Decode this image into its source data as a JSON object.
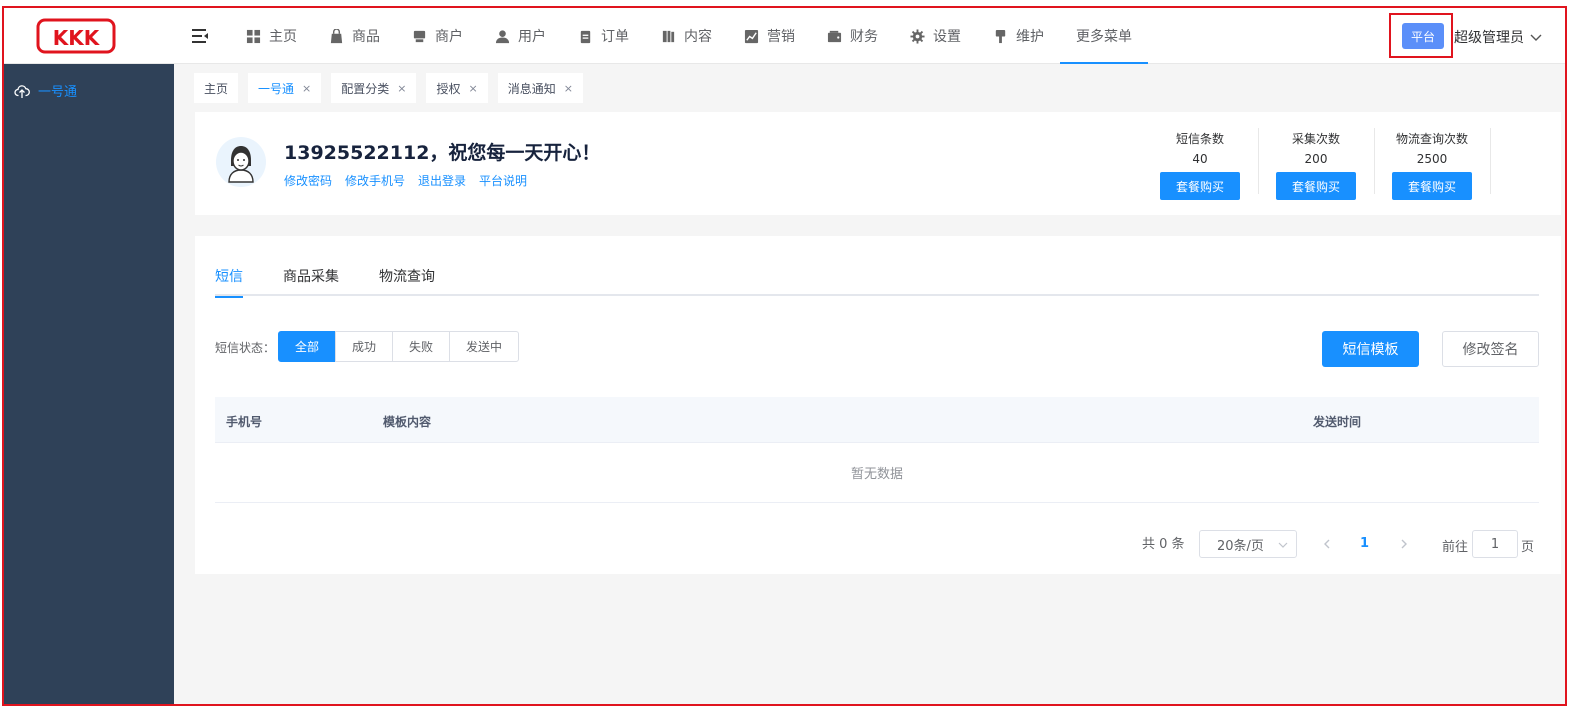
{
  "brand": {
    "logo_text": "KKK",
    "color": "#e0141e"
  },
  "nav": {
    "items": [
      {
        "label": "主页",
        "icon": "grid-icon"
      },
      {
        "label": "商品",
        "icon": "shopping-bag-icon"
      },
      {
        "label": "商户",
        "icon": "store-icon"
      },
      {
        "label": "用户",
        "icon": "user-icon"
      },
      {
        "label": "订单",
        "icon": "clipboard-icon"
      },
      {
        "label": "内容",
        "icon": "book-icon"
      },
      {
        "label": "营销",
        "icon": "chart-line-icon"
      },
      {
        "label": "财务",
        "icon": "wallet-icon"
      },
      {
        "label": "设置",
        "icon": "gear-icon"
      },
      {
        "label": "维护",
        "icon": "brush-icon"
      },
      {
        "label": "更多菜单",
        "icon": ""
      }
    ],
    "active": "更多菜单"
  },
  "header": {
    "platform_label": "平台",
    "admin_label": "超级管理员"
  },
  "sidebar": {
    "items": [
      {
        "label": "一号通",
        "icon": "cloud-upload-icon"
      }
    ]
  },
  "tags": [
    {
      "label": "主页",
      "closable": false
    },
    {
      "label": "一号通",
      "closable": true,
      "active": true
    },
    {
      "label": "配置分类",
      "closable": true
    },
    {
      "label": "授权",
      "closable": true
    },
    {
      "label": "消息通知",
      "closable": true
    }
  ],
  "profile": {
    "greeting": "13925522112，祝您每一天开心！",
    "links": [
      "修改密码",
      "修改手机号",
      "退出登录",
      "平台说明"
    ]
  },
  "stats": [
    {
      "label": "短信条数",
      "value": "40",
      "button": "套餐购买"
    },
    {
      "label": "采集次数",
      "value": "200",
      "button": "套餐购买"
    },
    {
      "label": "物流查询次数",
      "value": "2500",
      "button": "套餐购买"
    }
  ],
  "tabs": {
    "items": [
      "短信",
      "商品采集",
      "物流查询"
    ],
    "active": "短信"
  },
  "filter": {
    "label": "短信状态：",
    "options": [
      "全部",
      "成功",
      "失败",
      "发送中"
    ],
    "active": "全部"
  },
  "actions": {
    "template_button": "短信模板",
    "signature_button": "修改签名"
  },
  "table": {
    "columns": [
      "手机号",
      "模板内容",
      "发送时间"
    ],
    "empty_text": "暂无数据"
  },
  "pagination": {
    "total_text": "共 0 条",
    "page_size": "20条/页",
    "current_page": "1",
    "goto_label": "前往",
    "goto_value": "1",
    "page_unit": "页"
  }
}
